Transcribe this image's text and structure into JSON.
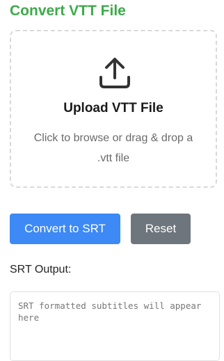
{
  "header": {
    "title": "Convert VTT File",
    "title_color": "#3daa4a"
  },
  "upload": {
    "icon": "upload-icon",
    "title": "Upload VTT File",
    "hint": "Click to browse or drag & drop a .vtt file"
  },
  "actions": {
    "convert_label": "Convert to SRT",
    "convert_color": "#3d89f5",
    "reset_label": "Reset",
    "reset_color": "#6d757d"
  },
  "output": {
    "label": "SRT Output:",
    "value": "",
    "placeholder": "SRT formatted subtitles will appear here"
  }
}
